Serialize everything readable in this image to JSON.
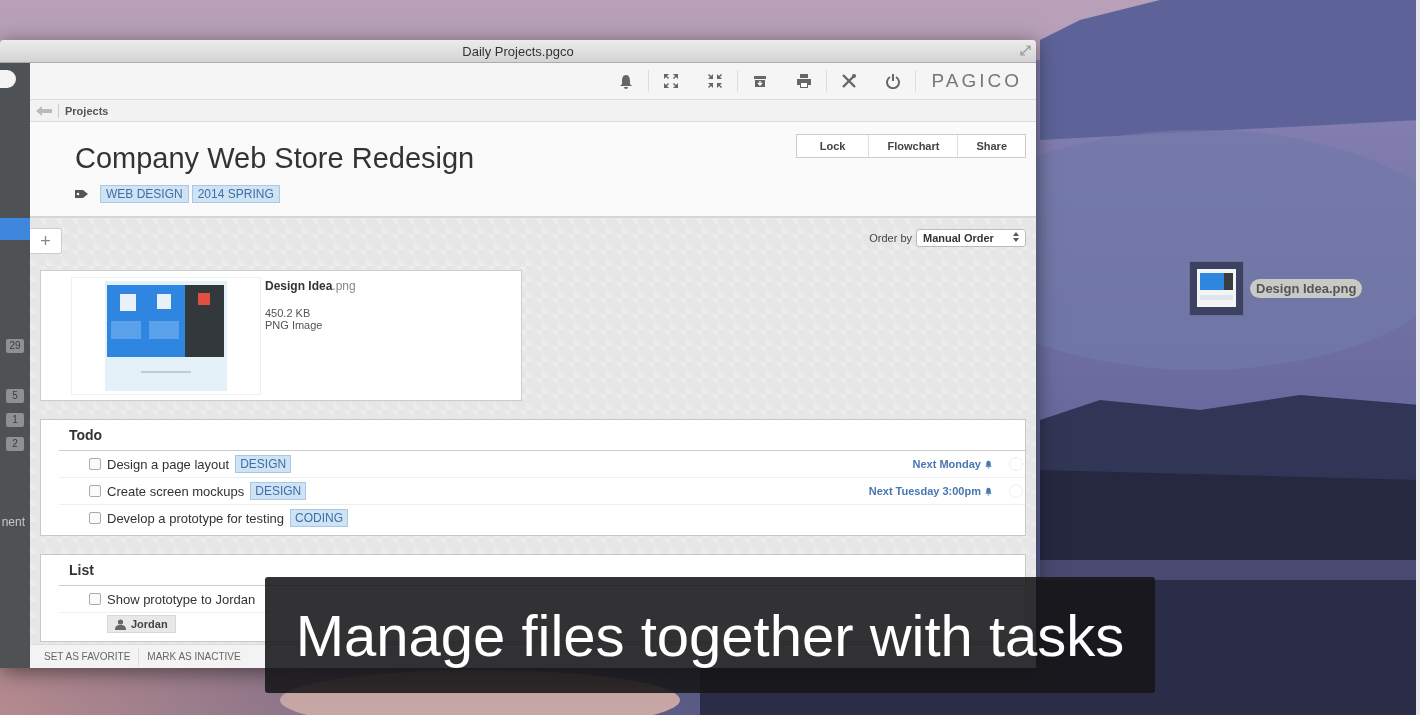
{
  "window": {
    "title": "Daily Projects.pgco"
  },
  "toolbar": {
    "logo": "PAGICO"
  },
  "sidebar": {
    "counts": [
      "29",
      "5",
      "1",
      "2"
    ],
    "cut_label": "nent"
  },
  "breadcrumb": "Projects",
  "project": {
    "title": "Company Web Store Redesign",
    "tags": [
      "WEB DESIGN",
      "2014 SPRING"
    ],
    "actions": [
      "Lock",
      "Flowchart",
      "Share"
    ]
  },
  "add_button": "+",
  "order_by": {
    "label": "Order by",
    "value": "Manual Order"
  },
  "attachment": {
    "name": "Design Idea",
    "extension": ".png",
    "size": "450.2 KB",
    "type": "PNG Image"
  },
  "lists": [
    {
      "title": "Todo",
      "tasks": [
        {
          "name": "Design a page layout",
          "tag": "DESIGN",
          "due": "Next Monday",
          "checked": false
        },
        {
          "name": "Create screen mockups",
          "tag": "DESIGN",
          "due": "Next Tuesday 3:00pm",
          "checked": false
        },
        {
          "name": "Develop a prototype for testing",
          "tag": "CODING",
          "checked": false
        }
      ]
    },
    {
      "title": "List",
      "tasks": [
        {
          "name": "Show prototype to Jordan",
          "assignee": "Jordan",
          "checked": false
        }
      ]
    }
  ],
  "bottom_actions": [
    "SET AS FAVORITE",
    "MARK AS INACTIVE"
  ],
  "desktop": {
    "file_label": "Design Idea.png"
  },
  "caption": "Manage files together with tasks"
}
